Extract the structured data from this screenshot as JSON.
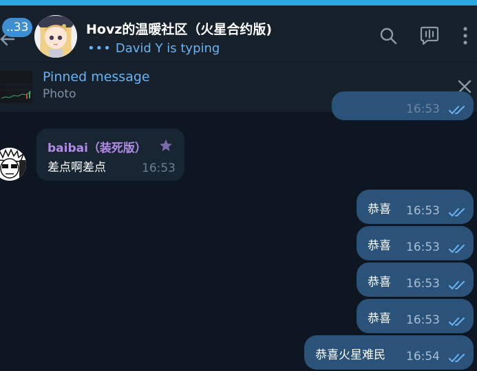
{
  "header": {
    "back_badge": "..33",
    "title": "Hovz的温暖社区（火星合约版)",
    "typing_dots": "•••",
    "typing_text": "David Y is typing"
  },
  "pinned": {
    "title": "Pinned message",
    "subtitle": "Photo"
  },
  "messages": {
    "top_time": "16:53",
    "incoming": {
      "sender": "baibai（装死版）",
      "text": "差点啊差点",
      "time": "16:53"
    },
    "outgoing": [
      {
        "text": "恭喜",
        "time": "16:53"
      },
      {
        "text": "恭喜",
        "time": "16:53"
      },
      {
        "text": "恭喜",
        "time": "16:53"
      },
      {
        "text": "恭喜",
        "time": "16:53"
      },
      {
        "text": "恭喜火星难民",
        "time": "16:54"
      }
    ]
  },
  "colors": {
    "accent": "#6ab3f3",
    "outgoing_bubble": "#2b5278",
    "incoming_bubble": "#182533",
    "sender_name": "#b18ce3",
    "background": "#0e1621"
  }
}
